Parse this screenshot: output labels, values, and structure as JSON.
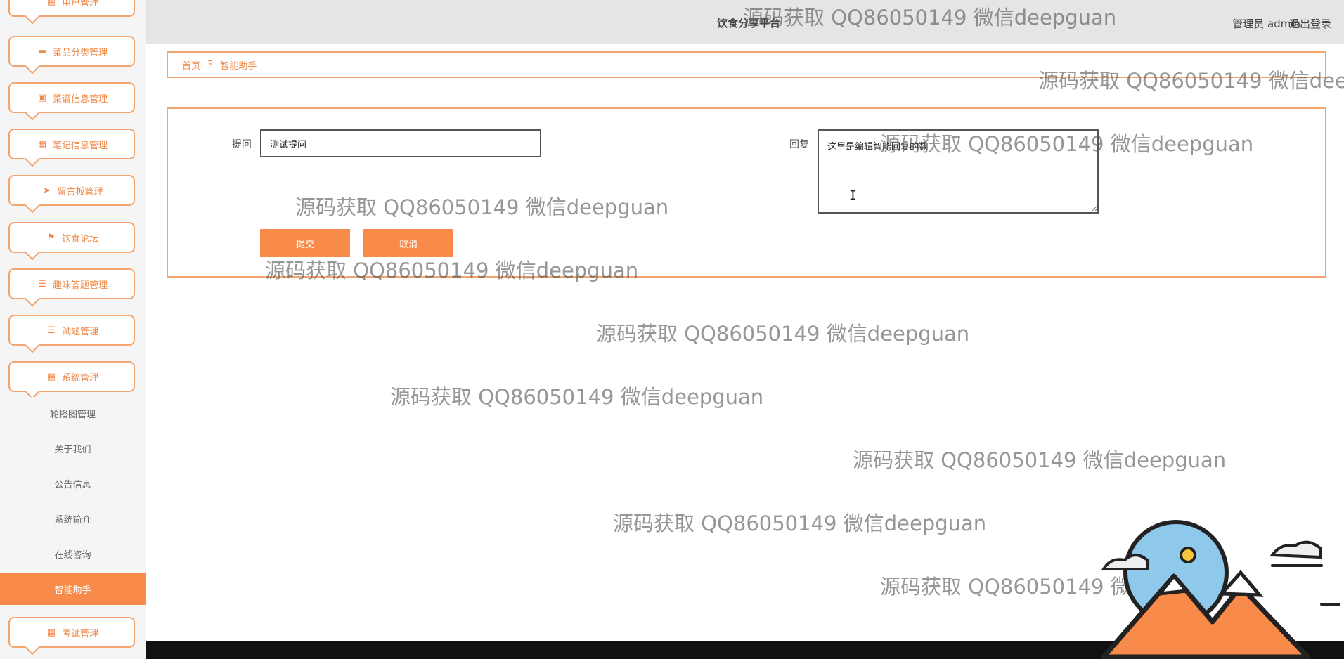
{
  "sidebar": {
    "menus": [
      {
        "label": "用户管理",
        "icon": "grid-icon"
      },
      {
        "label": "菜品分类管理",
        "icon": "monitor-icon"
      },
      {
        "label": "菜谱信息管理",
        "icon": "briefcase-icon"
      },
      {
        "label": "笔记信息管理",
        "icon": "grid9-icon"
      },
      {
        "label": "留言板管理",
        "icon": "send-icon"
      },
      {
        "label": "饮食论坛",
        "icon": "flag-icon"
      },
      {
        "label": "趣味答题管理",
        "icon": "list-icon"
      },
      {
        "label": "试题管理",
        "icon": "list-icon"
      },
      {
        "label": "系统管理",
        "icon": "grid-icon"
      }
    ],
    "submenu": [
      {
        "label": "轮播图管理"
      },
      {
        "label": "关于我们"
      },
      {
        "label": "公告信息"
      },
      {
        "label": "系统简介"
      },
      {
        "label": "在线咨询"
      },
      {
        "label": "智能助手"
      }
    ],
    "bottom_menu": {
      "label": "考试管理",
      "icon": "grid-icon"
    }
  },
  "header": {
    "title": "饮食分享平台",
    "user": "管理员 admin",
    "logout": "退出登录"
  },
  "breadcrumb": {
    "home": "首页",
    "separator": "Ξ",
    "current": "智能助手"
  },
  "form": {
    "question_label": "提问",
    "question_value": "测试提问",
    "answer_label": "回复",
    "answer_value": "这里是编辑智能回复的数",
    "submit_label": "提交",
    "cancel_label": "取消"
  },
  "watermark": "源码获取 QQ86050149 微信deepguan",
  "colors": {
    "accent": "#f98b4a",
    "border": "#f2a56f",
    "header_bg": "#e5e5e5"
  }
}
